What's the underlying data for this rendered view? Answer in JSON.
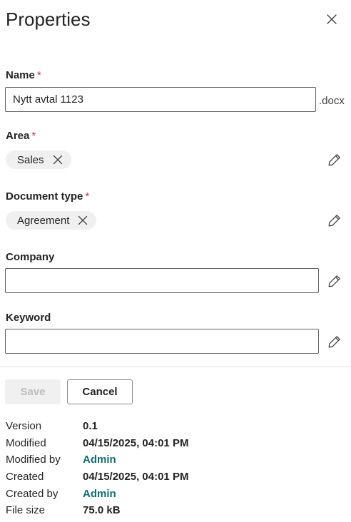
{
  "panel": {
    "title": "Properties"
  },
  "fields": {
    "required_marker": "*",
    "name": {
      "label": "Name",
      "value": "Nytt avtal 1123",
      "extension": ".docx"
    },
    "area": {
      "label": "Area",
      "tag": "Sales"
    },
    "document_type": {
      "label": "Document type",
      "tag": "Agreement"
    },
    "company": {
      "label": "Company",
      "value": ""
    },
    "keyword": {
      "label": "Keyword",
      "value": ""
    }
  },
  "actions": {
    "save_label": "Save",
    "cancel_label": "Cancel"
  },
  "details": {
    "version": {
      "label": "Version",
      "value": "0.1"
    },
    "modified": {
      "label": "Modified",
      "value": "04/15/2025, 04:01 PM"
    },
    "modified_by": {
      "label": "Modified by",
      "value": "Admin"
    },
    "created": {
      "label": "Created",
      "value": "04/15/2025, 04:01 PM"
    },
    "created_by": {
      "label": "Created by",
      "value": "Admin"
    },
    "file_size": {
      "label": "File size",
      "value": "75.0 kB"
    }
  },
  "icons": {
    "close": "close-icon",
    "remove_tag": "dismiss-icon",
    "edit": "pencil-icon"
  },
  "colors": {
    "required": "#c4314b",
    "link": "#0f6f6f",
    "tag_background": "#f0f0f0",
    "disabled_text": "#bdbdbd"
  }
}
